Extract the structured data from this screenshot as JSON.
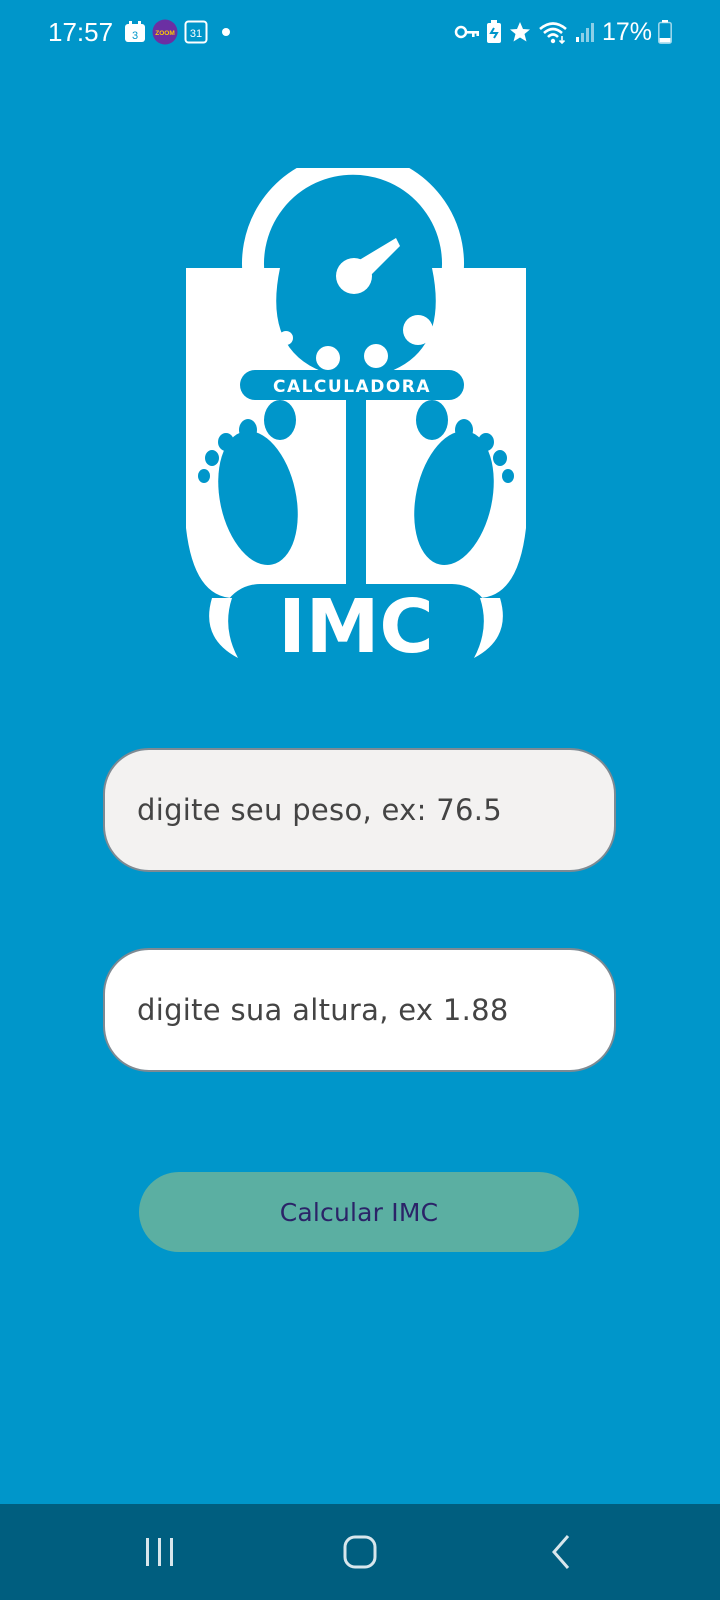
{
  "status_bar": {
    "time": "17:57",
    "calendar_day": "3",
    "app_badge": "ZOOM",
    "date_badge": "31",
    "battery_percent": "17%"
  },
  "logo": {
    "top_text": "CALCULADORA",
    "main_text": "IMC"
  },
  "form": {
    "weight_placeholder": "digite seu peso, ex: 76.5",
    "height_placeholder": "digite sua altura, ex 1.88",
    "button_label": "Calcular IMC"
  },
  "colors": {
    "background": "#0096ca",
    "button": "#5bafa2",
    "button_text": "#2b2368",
    "nav_bar": "#005e7f"
  },
  "nav_bar": {
    "icons": [
      "recent-apps-icon",
      "home-icon",
      "back-icon"
    ]
  }
}
